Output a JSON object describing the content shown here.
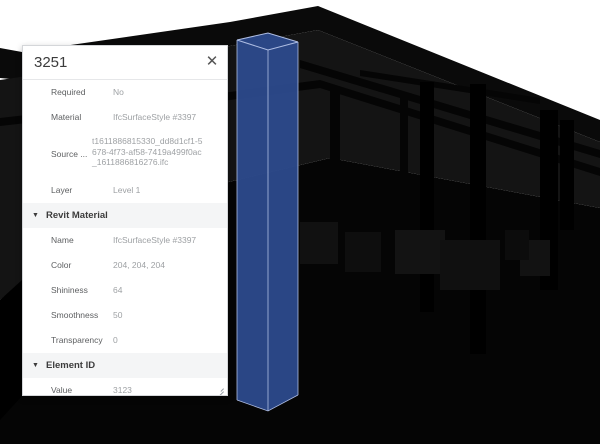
{
  "panel": {
    "title": "3251",
    "close_icon": "close-icon",
    "rows_top": [
      {
        "label": "Required",
        "value": "No"
      },
      {
        "label": "Material",
        "value": "IfcSurfaceStyle #3397"
      },
      {
        "label": "Source ...",
        "value": "t1611886815330_dd8d1cf1-5678-4f73-af58-7419a499f0ac_1611886816276.ifc"
      },
      {
        "label": "Layer",
        "value": "Level 1"
      }
    ],
    "sections": [
      {
        "title": "Revit Material",
        "rows": [
          {
            "label": "Name",
            "value": "IfcSurfaceStyle #3397"
          },
          {
            "label": "Color",
            "value": "204, 204, 204"
          },
          {
            "label": "Shininess",
            "value": "64"
          },
          {
            "label": "Smoothness",
            "value": "50"
          },
          {
            "label": "Transparency",
            "value": "0"
          }
        ]
      },
      {
        "title": "Element ID",
        "rows": [
          {
            "label": "Value",
            "value": "3123"
          }
        ]
      }
    ]
  },
  "viewport": {
    "background": "#ffffff",
    "model_color": "#0b0b0b",
    "selection_color": "#2c4a8c",
    "selection_edge": "#aebde3"
  }
}
